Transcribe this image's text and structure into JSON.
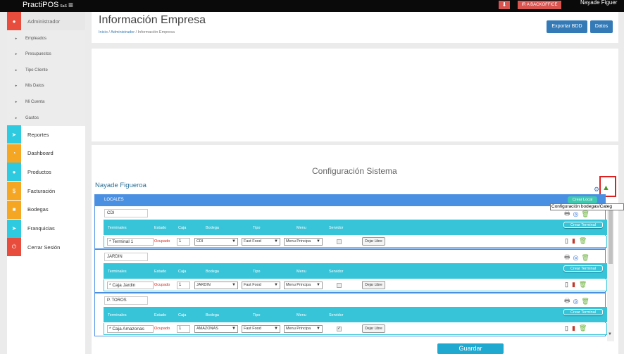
{
  "topbar": {
    "brand": "PractiPOS",
    "brand_sub": "SaS",
    "download_icon": "download-icon",
    "backoffice_label": "IR A BACKOFFICE",
    "user_name": "Nayade Figuer"
  },
  "sidebar": {
    "admin_label": "Administrador",
    "sub_items": [
      "Empleados",
      "Presupuestos",
      "Tipo Cliente",
      "Mis Datos",
      "Mi Cuenta",
      "Gastos"
    ],
    "items": [
      {
        "label": "Reportes",
        "color": "#2ecbe0",
        "icon": "rocket-icon",
        "glyph": "➤"
      },
      {
        "label": "Dashboard",
        "color": "#f5a623",
        "icon": "dashboard-icon",
        "glyph": "◔"
      },
      {
        "label": "Productos",
        "color": "#2ecbe0",
        "icon": "products-icon",
        "glyph": "●"
      },
      {
        "label": "Facturación",
        "color": "#f5a623",
        "icon": "dollar-icon",
        "glyph": "$"
      },
      {
        "label": "Bodegas",
        "color": "#f5a623",
        "icon": "warehouse-icon",
        "glyph": "■"
      },
      {
        "label": "Franquicias",
        "color": "#2ecbe0",
        "icon": "franchise-icon",
        "glyph": "➤"
      },
      {
        "label": "Cerrar Sesión",
        "color": "#e74c3c",
        "icon": "power-icon",
        "glyph": "⏻"
      }
    ]
  },
  "header": {
    "title": "Información Empresa",
    "breadcrumb": [
      "Inicio",
      "Administrador",
      "Información Empresa"
    ],
    "export_label": "Exportar BDD",
    "datos_label": "Datos"
  },
  "config": {
    "title": "Configuración Sistema",
    "owner": "Nayade Figueroa",
    "tooltip": "Configuración bodegas/Categ",
    "locales_label": "LOCALES",
    "crear_local": "Crear Local",
    "crear_terminal": "Crear Terminal",
    "columns": [
      "Terminales",
      "Estado",
      "Caja",
      "Bodega",
      "Tipo",
      "Menu",
      "Servidor"
    ],
    "dejar_libre": "Dejar Libre",
    "locales": [
      {
        "name": "CDI",
        "terminal": {
          "name": "Terminal 1",
          "estado": "Ocupado",
          "caja": "1",
          "bodega": "CDI",
          "tipo": "Fast Food",
          "menu": "Menu Principa",
          "servidor": false
        }
      },
      {
        "name": "JARDIN",
        "terminal": {
          "name": "Caja Jardin",
          "estado": "Ocupado",
          "caja": "1",
          "bodega": "JARDIN",
          "tipo": "Fast Food",
          "menu": "Menu Principa",
          "servidor": false
        }
      },
      {
        "name": "P. TOROS",
        "terminal": {
          "name": "Caja Amazonas",
          "estado": "Ocupado",
          "caja": "1",
          "bodega": "AMAZONAS",
          "tipo": "Fast Food",
          "menu": "Menu Principa",
          "servidor": true
        }
      }
    ]
  },
  "guardar_label": "Guardar"
}
